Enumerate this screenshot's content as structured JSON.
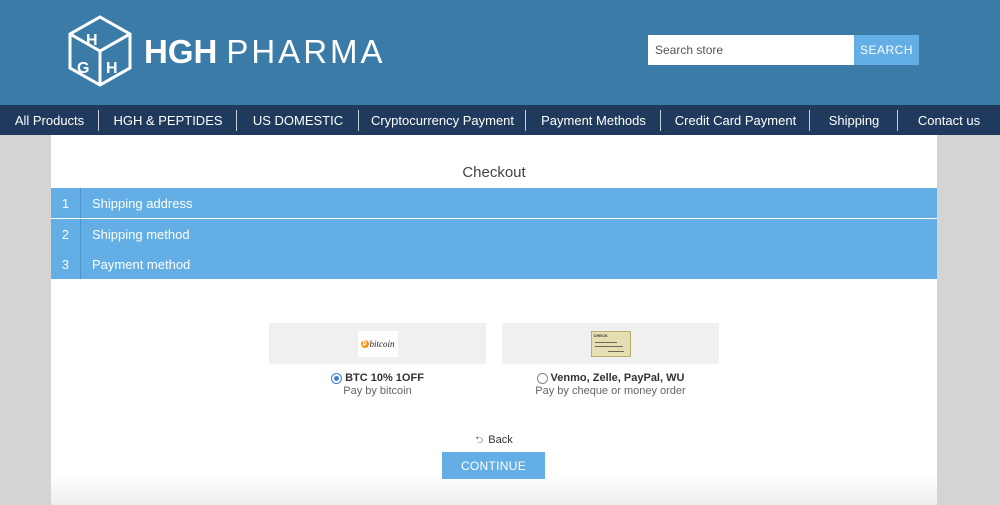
{
  "brand": {
    "name_bold": "HGH",
    "name_thin": "PHARMA",
    "primary_color": "#3a7ba8",
    "accent_color": "#64aee6",
    "nav_color": "#1f3a5c"
  },
  "search": {
    "placeholder": "Search store",
    "button_label": "SEARCH"
  },
  "nav": {
    "items": [
      "All Products",
      "HGH & PEPTIDES",
      "US DOMESTIC",
      "Cryptocurrency Payment",
      "Payment Methods",
      "Credit Card Payment",
      "Shipping",
      "Contact us"
    ]
  },
  "checkout": {
    "title": "Checkout",
    "steps": [
      {
        "num": "1",
        "label": "Shipping address"
      },
      {
        "num": "2",
        "label": "Shipping method"
      },
      {
        "num": "3",
        "label": "Payment method"
      }
    ],
    "methods": [
      {
        "logo_text": "bitcoin",
        "logo_icon": "bitcoin-logo",
        "option": "BTC 10% 1OFF",
        "description": "Pay by bitcoin",
        "selected": true
      },
      {
        "logo_text": "CHECK",
        "logo_icon": "cheque-logo",
        "option": "Venmo, Zelle, PayPal, WU",
        "description": "Pay by cheque or money order",
        "selected": false
      }
    ],
    "back_label": "Back",
    "continue_label": "CONTINUE"
  }
}
